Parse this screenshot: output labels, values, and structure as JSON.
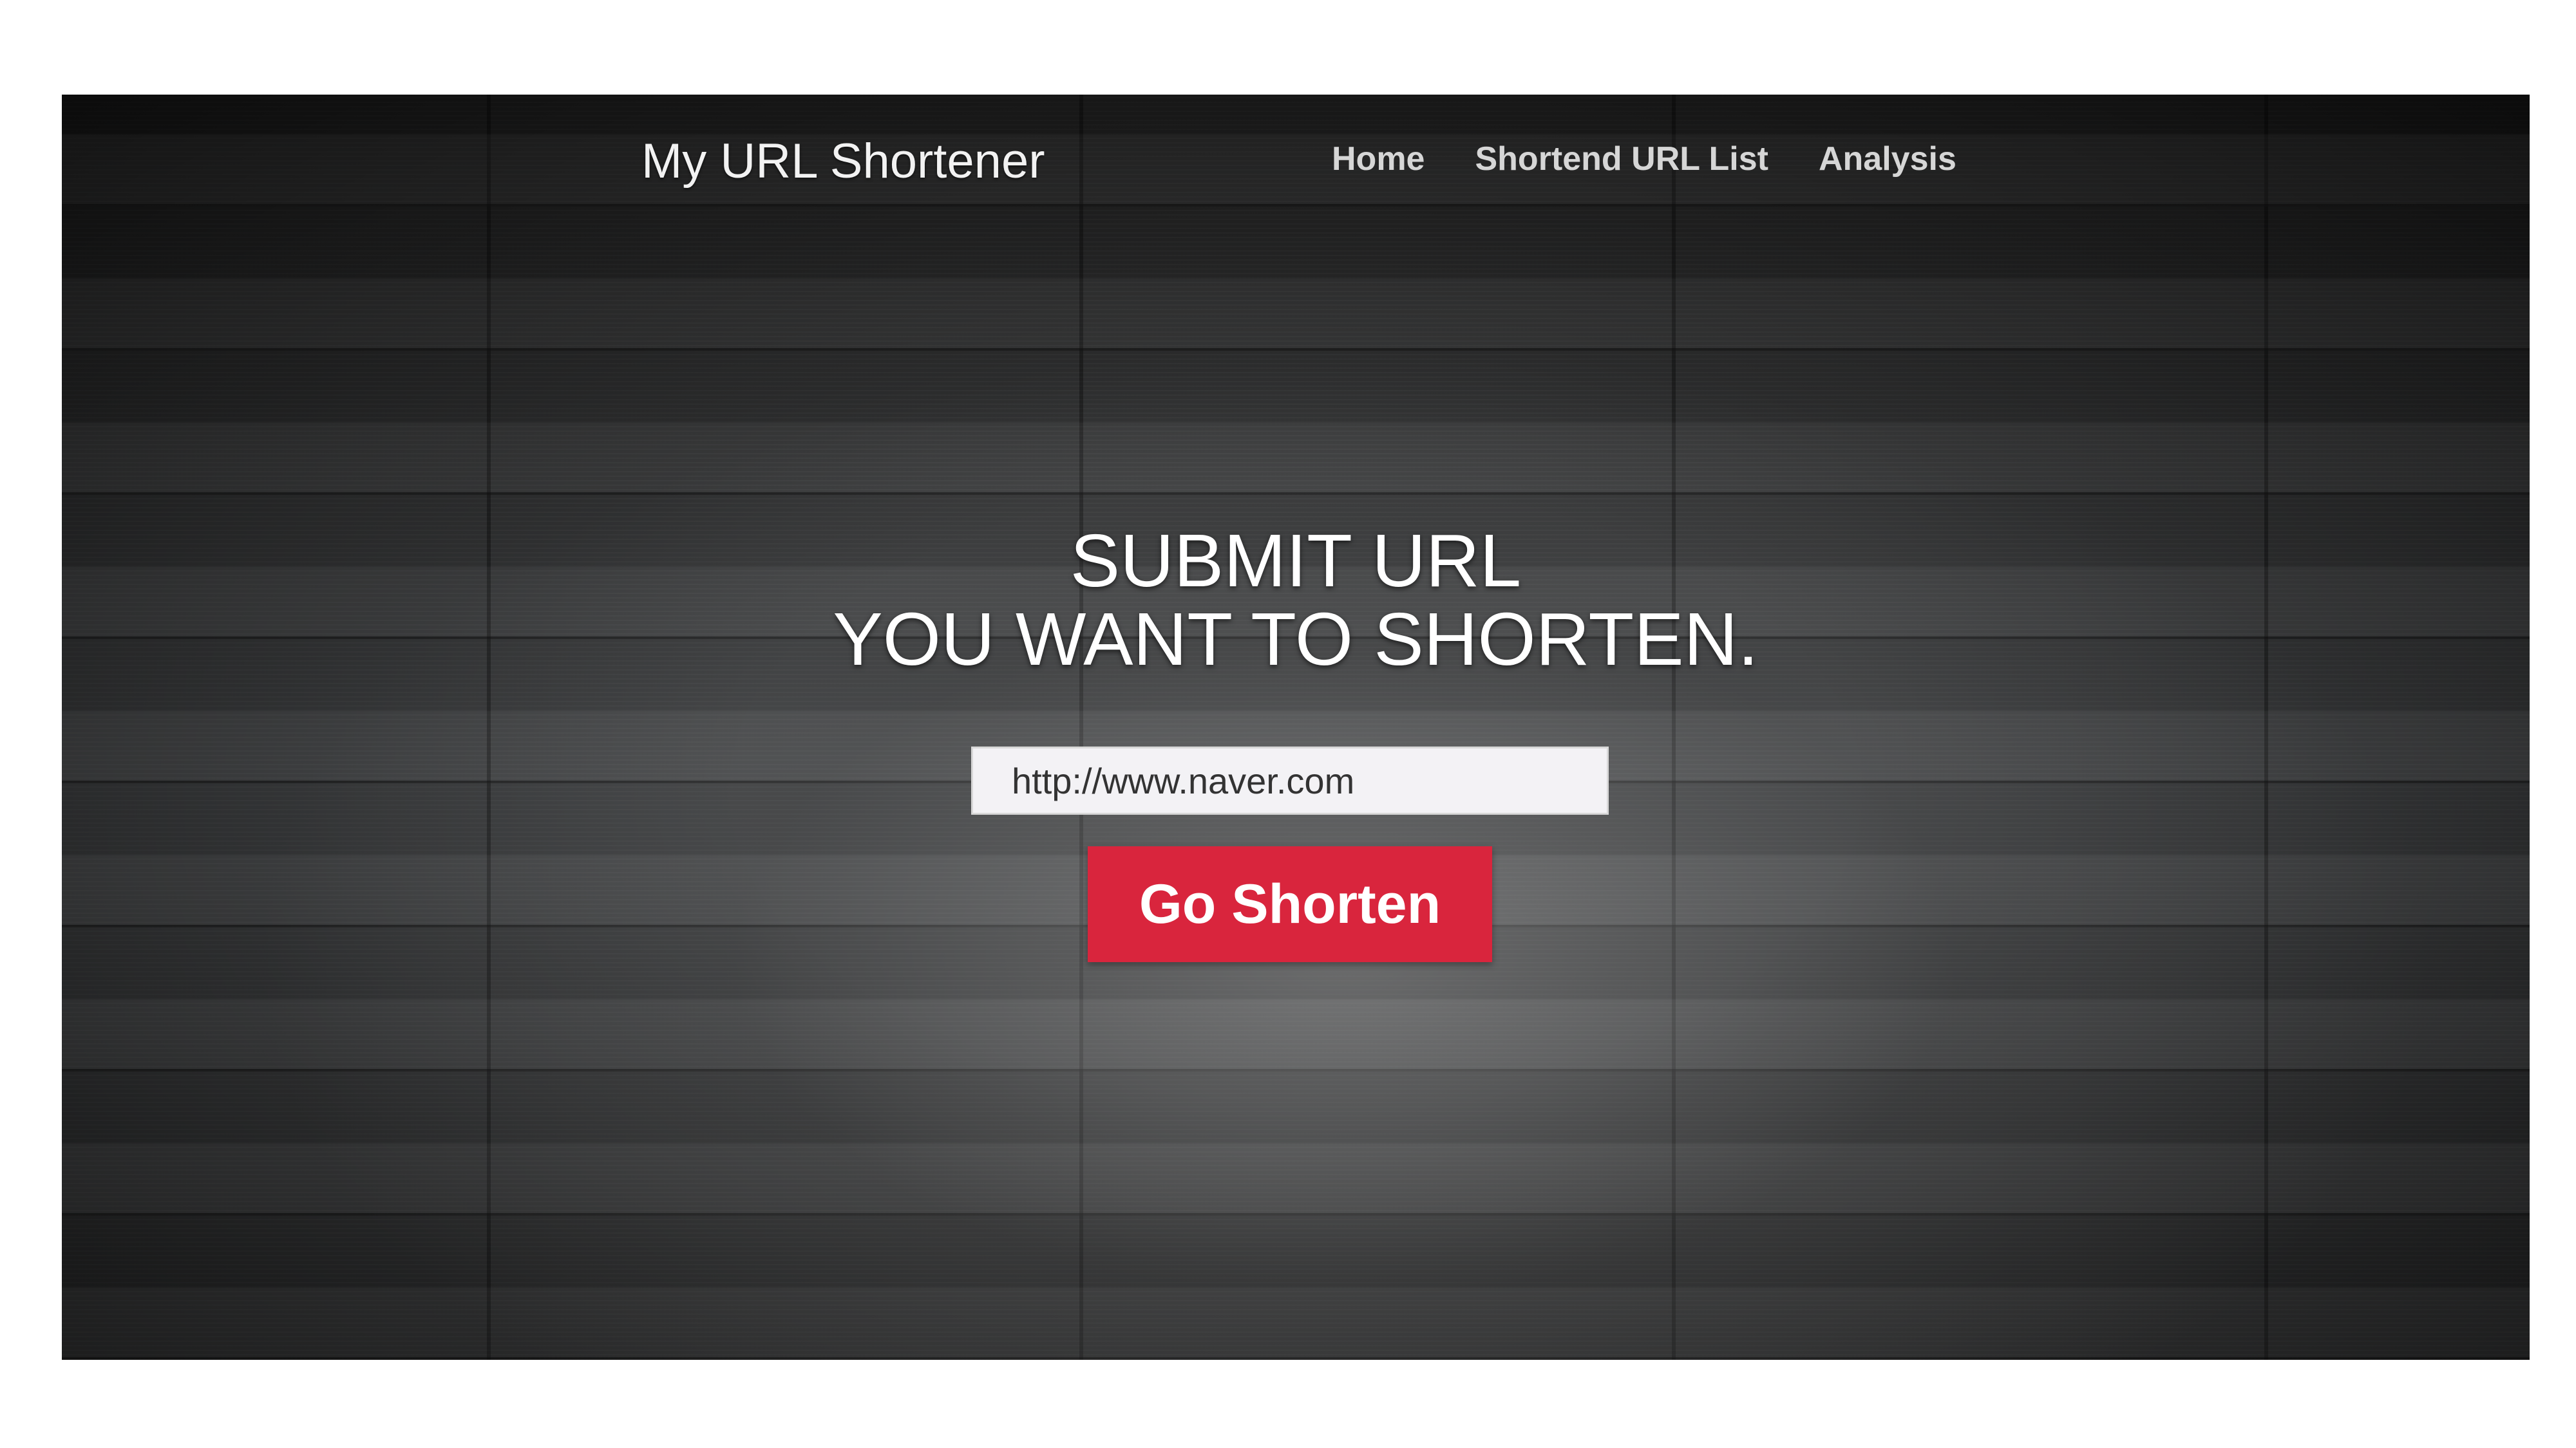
{
  "app": {
    "brand": "My URL Shortener"
  },
  "nav": {
    "items": [
      {
        "label": "Home"
      },
      {
        "label": "Shortend URL List"
      },
      {
        "label": "Analysis"
      }
    ]
  },
  "hero": {
    "line1": "SUBMIT URL",
    "line2": "YOU WANT TO SHORTEN."
  },
  "form": {
    "url_value": "http://www.naver.com",
    "submit_label": "Go Shorten"
  },
  "colors": {
    "accent": "#d9253d"
  }
}
